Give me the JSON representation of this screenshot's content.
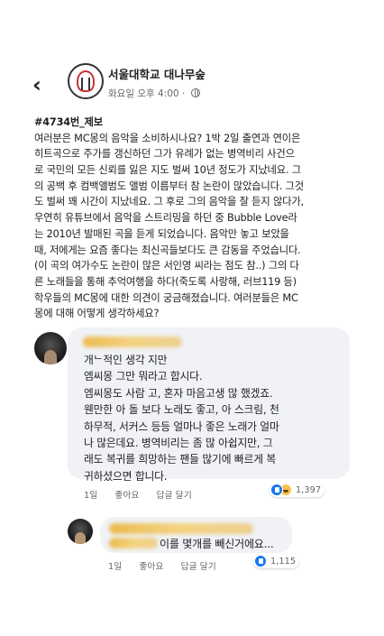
{
  "header": {
    "page_name": "서울대학교 대나무숲",
    "time": "화요일 오후 4:00",
    "separator": "·"
  },
  "icons": {
    "back": "back-arrow-icon",
    "audience": "globe-icon",
    "like": "like-reaction-icon",
    "haha": "haha-reaction-icon"
  },
  "post": {
    "tag": "#4734번_제보",
    "lines": [
      "여러분은 MC몽의 음악을 소비하시나요? 1박 2일 출연과 연이은",
      "히트곡으로 주가를 갱신하던 그가 유례가 없는 병역비리 사건으",
      "로 국민의 모든 신뢰를 잃은 지도 벌써 10년 정도가 지났네요. 그",
      "의 공백 후 컴백앨범도 앨범 이름부터 참 논란이 많았습니다. 그것",
      "도 벌써 꽤 시간이 지났네요. 그 후로 그의 음악을 잘 듣지 않다가,",
      "우연히 유튜브에서 음악을 스트리밍을 하던 중 Bubble Love라",
      "는 2010년 발매된 곡을 듣게 되었습니다. 음악만 놓고 보았을",
      "때, 저에게는 요즘 좋다는 최신곡들보다도 큰 감동을 주었습니다.",
      "(이 곡의 여가수도 논란이 많은 서인영 씨라는 점도 참..) 그의 다",
      "른 노래들을 통해 추억여행을 하다(죽도록 사랑해, 러브119 등)",
      "학우들의 MC몽에 대한 의견이 궁금해졌습니다. 여러분들은 MC",
      "몽에 대해 어떻게 생각하세요?"
    ]
  },
  "comments": [
    {
      "lines": [
        "개ᄂ적인 생각 지만",
        "엠씨몽 그만 뭐라고 합시다.",
        "엠씨몽도 사람 고, 혼자 마음고생 많 했겠죠.",
        "웬만한 아 돌 보다 노래도 좋고, 아 스크림, 천",
        "하무적, 서커스 등등 얼마나 좋은 노래가 얼마",
        "나 많은데요. 병역비리는 좀 많 아쉽지만, 그",
        "래도 복귀를 희망하는 팬들 많기에 빠르게 복",
        "귀하셨으면 합니다."
      ],
      "time": "1일",
      "like_label": "좋아요",
      "reply_label": "답글 달기",
      "reaction_count": "1,397"
    },
    {
      "text": "이를 몇개를 빼신거에요...",
      "time": "1일",
      "like_label": "좋아요",
      "reply_label": "답글 달기",
      "reaction_count": "1,115"
    }
  ]
}
